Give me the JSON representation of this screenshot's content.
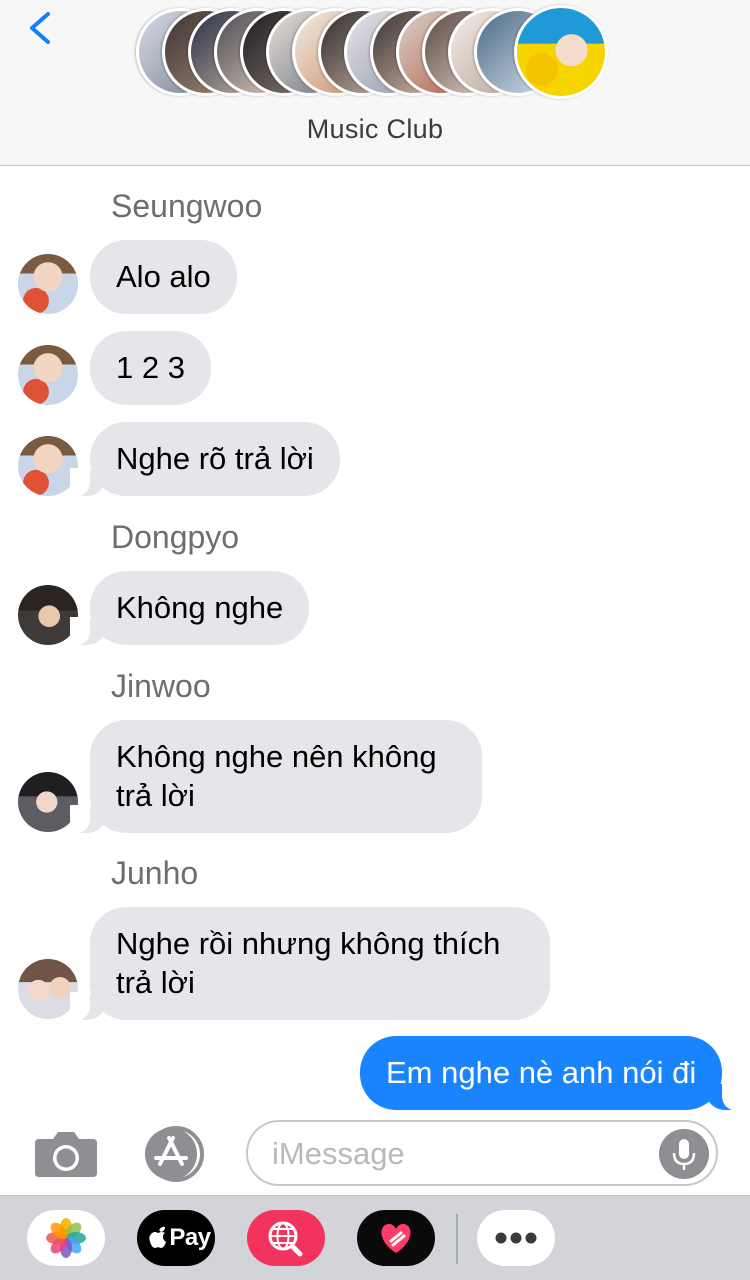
{
  "header": {
    "group_name": "Music Club"
  },
  "messages": [
    {
      "sender": "Seungwoo",
      "text": "Alo alo"
    },
    {
      "sender": "Seungwoo",
      "text": "1 2 3"
    },
    {
      "sender": "Seungwoo",
      "text": "Nghe rõ trả lời"
    },
    {
      "sender": "Dongpyo",
      "text": "Không nghe"
    },
    {
      "sender": "Jinwoo",
      "text": "Không nghe nên không trả lời"
    },
    {
      "sender": "Junho",
      "text": "Nghe rồi nhưng không thích trả lời"
    },
    {
      "sender": "me",
      "text": "Em nghe nè anh nói đi"
    }
  ],
  "compose": {
    "placeholder": "iMessage"
  },
  "app_drawer": {
    "apple_pay_label": "Pay"
  },
  "colors": {
    "incoming_bubble": "#e5e5ea",
    "outgoing_bubble": "#1a84ff",
    "ios_blue": "#147efb",
    "search_app": "#f2335e"
  },
  "icons": {
    "back": "chevron-left-icon",
    "camera": "camera-icon",
    "app_store": "app-store-icon",
    "microphone": "microphone-icon",
    "photos": "photos-app-icon",
    "apple_pay": "apple-pay-icon",
    "web_search": "globe-search-icon",
    "digital_touch": "heart-touch-icon",
    "more": "more-dots-icon"
  }
}
